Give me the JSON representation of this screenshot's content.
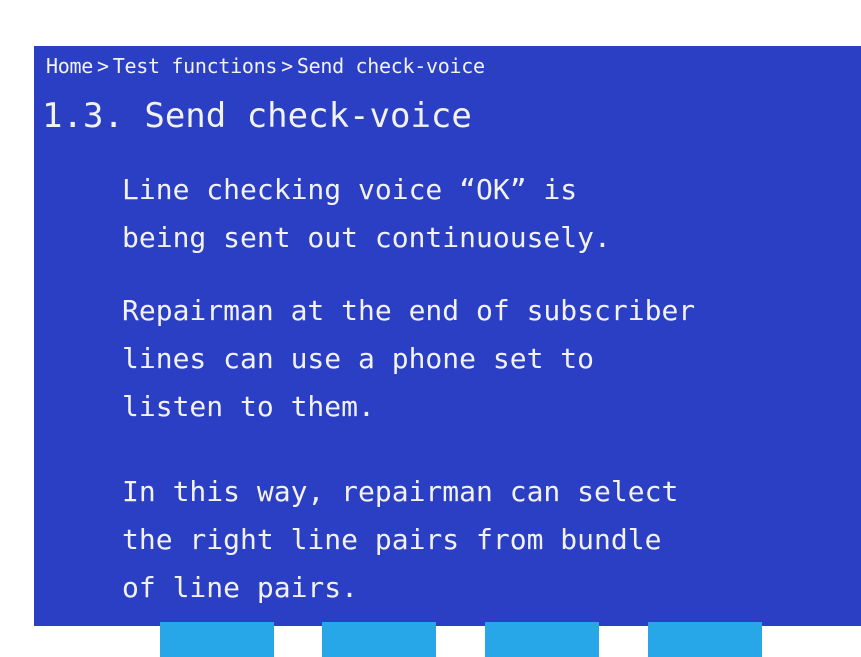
{
  "breadcrumb": {
    "items": [
      "Home",
      "Test functions",
      "Send check-voice"
    ],
    "separator": ">"
  },
  "page": {
    "title": "1.3. Send check-voice",
    "paragraphs": [
      "Line checking voice “OK” is\nbeing sent out continuousely.",
      "Repairman at the end of subscriber\nlines can use a phone set to\nlisten to them.",
      "In this way, repairman can select\nthe right line pairs from bundle\nof line pairs."
    ]
  },
  "softkeys": {
    "count": 4,
    "color": "#27a7e8"
  },
  "colors": {
    "background": "#2b3fc4",
    "text": "#f2f2f2"
  }
}
